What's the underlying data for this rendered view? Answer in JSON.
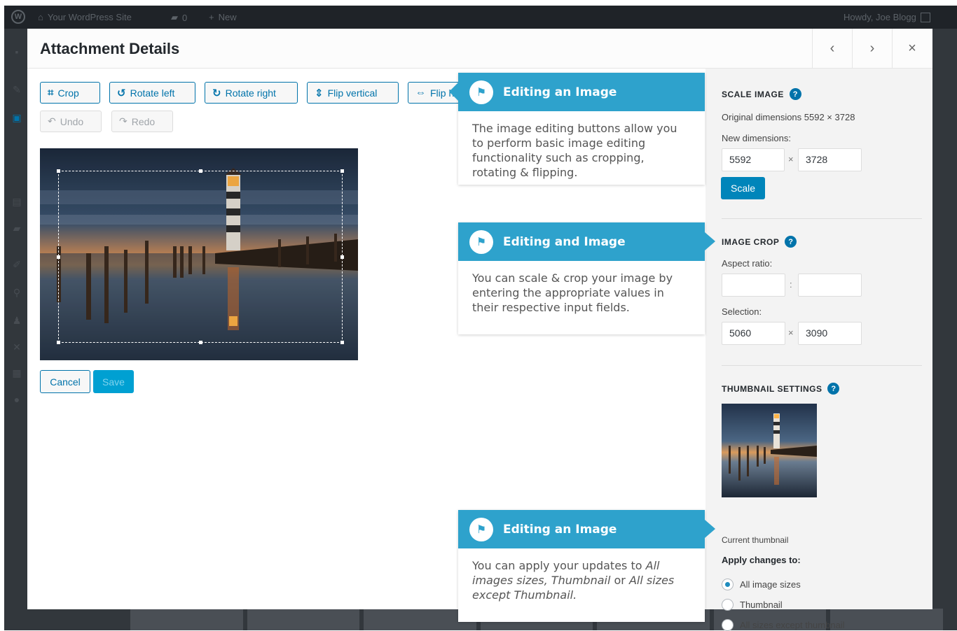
{
  "adminbar": {
    "site_name": "Your WordPress Site",
    "comments_count": "0",
    "new_label": "New",
    "greeting": "Howdy, Joe Blogg"
  },
  "modal": {
    "title": "Attachment Details",
    "prev_icon": "chevron-left-icon",
    "next_icon": "chevron-right-icon",
    "close_icon": "close-icon"
  },
  "toolbar": {
    "crop": "Crop",
    "rotate_left": "Rotate left",
    "rotate_right": "Rotate right",
    "flip_vertical": "Flip vertical",
    "flip_horizontal": "Flip horizontal",
    "undo": "Undo",
    "redo": "Redo"
  },
  "actions": {
    "cancel": "Cancel",
    "save": "Save"
  },
  "scale_image": {
    "title": "Scale Image",
    "original": "Original dimensions 5592 × 3728",
    "new_label": "New dimensions:",
    "width": "5592",
    "height": "3728",
    "separator": "×",
    "button": "Scale"
  },
  "image_crop": {
    "title": "Image Crop",
    "aspect_label": "Aspect ratio:",
    "aspect_w": "",
    "aspect_h": "",
    "aspect_sep": ":",
    "selection_label": "Selection:",
    "sel_w": "5060",
    "sel_h": "3090",
    "separator": "×"
  },
  "thumbnail": {
    "title": "Thumbnail Settings",
    "caption": "Current thumbnail",
    "apply_label": "Apply changes to:",
    "options": [
      {
        "label": "All image sizes",
        "checked": true
      },
      {
        "label": "Thumbnail",
        "checked": false
      },
      {
        "label": "All sizes except thumbnail",
        "checked": false
      }
    ]
  },
  "callouts": [
    {
      "title": "Editing an Image",
      "body": "The image editing buttons allow you to perform basic image editing functionality such as cropping, rotating & flipping."
    },
    {
      "title": "Editing and Image",
      "body": "You can scale & crop your image by entering the appropriate values in their respective input fields."
    },
    {
      "title": "Editing an Image",
      "body_parts": [
        "You can apply your updates to ",
        "All images sizes, Thumbnail",
        " or ",
        "All sizes except Thumbnail."
      ]
    }
  ],
  "colors": {
    "accent": "#0073aa",
    "tour": "#2ea2cc",
    "adminbar": "#1f2328"
  }
}
